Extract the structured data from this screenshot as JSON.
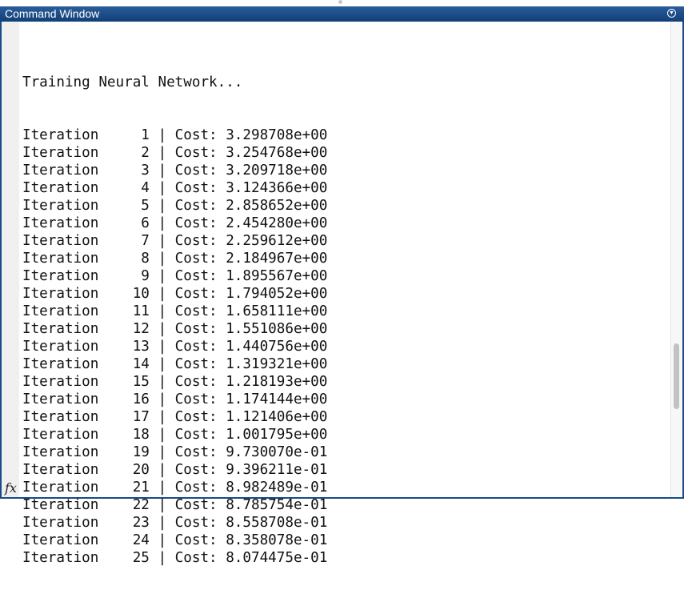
{
  "window": {
    "title": "Command Window",
    "menu_icon": "chevron-down-circle-icon",
    "prompt_icon": "fx"
  },
  "output": {
    "header": "Training Neural Network...",
    "iterations": [
      {
        "n": 1,
        "cost": "3.298708e+00"
      },
      {
        "n": 2,
        "cost": "3.254768e+00"
      },
      {
        "n": 3,
        "cost": "3.209718e+00"
      },
      {
        "n": 4,
        "cost": "3.124366e+00"
      },
      {
        "n": 5,
        "cost": "2.858652e+00"
      },
      {
        "n": 6,
        "cost": "2.454280e+00"
      },
      {
        "n": 7,
        "cost": "2.259612e+00"
      },
      {
        "n": 8,
        "cost": "2.184967e+00"
      },
      {
        "n": 9,
        "cost": "1.895567e+00"
      },
      {
        "n": 10,
        "cost": "1.794052e+00"
      },
      {
        "n": 11,
        "cost": "1.658111e+00"
      },
      {
        "n": 12,
        "cost": "1.551086e+00"
      },
      {
        "n": 13,
        "cost": "1.440756e+00"
      },
      {
        "n": 14,
        "cost": "1.319321e+00"
      },
      {
        "n": 15,
        "cost": "1.218193e+00"
      },
      {
        "n": 16,
        "cost": "1.174144e+00"
      },
      {
        "n": 17,
        "cost": "1.121406e+00"
      },
      {
        "n": 18,
        "cost": "1.001795e+00"
      },
      {
        "n": 19,
        "cost": "9.730070e-01"
      },
      {
        "n": 20,
        "cost": "9.396211e-01"
      },
      {
        "n": 21,
        "cost": "8.982489e-01"
      },
      {
        "n": 22,
        "cost": "8.785754e-01"
      },
      {
        "n": 23,
        "cost": "8.558708e-01"
      },
      {
        "n": 24,
        "cost": "8.358078e-01"
      },
      {
        "n": 25,
        "cost": "8.074475e-01"
      }
    ],
    "iteration_label": "Iteration",
    "cost_label": "Cost:"
  }
}
